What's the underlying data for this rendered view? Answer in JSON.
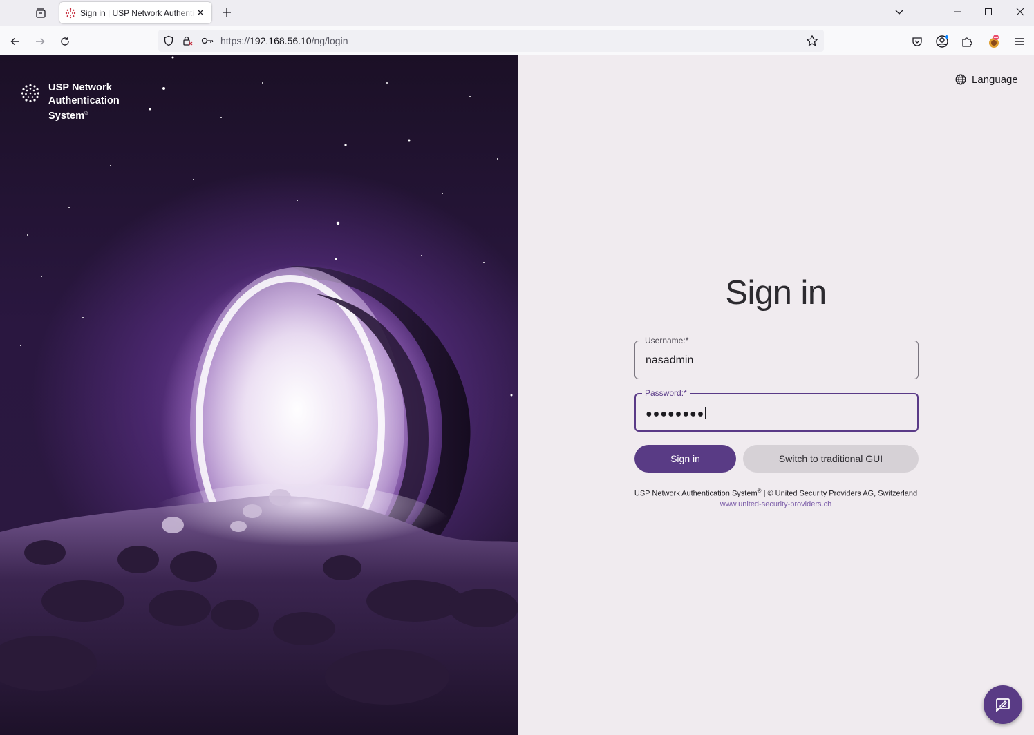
{
  "browser": {
    "tab": {
      "title": "Sign in | USP Network Authentication System"
    },
    "url": {
      "scheme": "https://",
      "host": "192.168.56.10",
      "path": "/ng/login"
    }
  },
  "brand": {
    "line1": "USP Network",
    "line2": "Authentication",
    "line3": "System",
    "mark": "®"
  },
  "login": {
    "language_label": "Language",
    "title": "Sign in",
    "username": {
      "label": "Username:*",
      "value": "nasadmin"
    },
    "password": {
      "label": "Password:*",
      "value": "●●●●●●●●"
    },
    "sign_in_label": "Sign in",
    "switch_label": "Switch to traditional GUI",
    "footer": {
      "product": "USP Network Authentication System",
      "mark": "®",
      "rest": " | © United Security Providers AG, Switzerland",
      "link": "www.united-security-providers.ch"
    }
  },
  "colors": {
    "accent": "#593b85",
    "panel_bg": "#f0ebef",
    "secondary_button": "#d6d1d6",
    "link": "#7b5ca8"
  },
  "icons": {
    "tab_list": "tab-list-icon",
    "favicon": "usp-favicon-icon",
    "tab_close": "close-icon",
    "new_tab": "plus-icon",
    "chevron": "chevron-down-icon",
    "back": "back-arrow-icon",
    "forward": "forward-arrow-icon",
    "reload": "reload-icon",
    "shield": "shield-icon",
    "lock": "lock-icon",
    "key": "key-icon",
    "star": "star-icon",
    "pocket": "pocket-icon",
    "account": "account-icon",
    "extensions": "puzzle-icon",
    "menu": "hamburger-menu-icon",
    "globe": "globe-icon",
    "feedback": "feedback-icon"
  }
}
